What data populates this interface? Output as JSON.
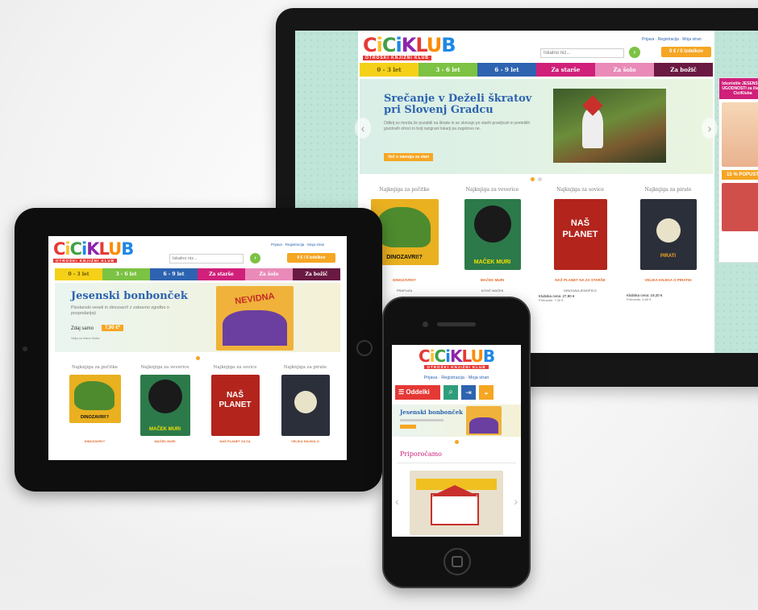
{
  "site": {
    "logo_letters": [
      "C",
      "i",
      "C",
      "i",
      "K",
      "L",
      "U",
      "B"
    ],
    "logo_tag": "OTROŠKI KNJIŽNI KLUB",
    "toplinks": "Prijava · Registracija · Moja stran",
    "search_placeholder": "Iskalno niz...",
    "cart_label": "0 € / 0 izdelkov",
    "nav": [
      "0 - 3 let",
      "3 - 6 let",
      "6 - 9 let",
      "Za starše",
      "Za šolo",
      "Za božič"
    ],
    "columns": [
      "Najknjiga za počitke",
      "Najknjiga za veverice",
      "Najknjiga za sovice",
      "Najknjiga za pirate"
    ],
    "products": [
      "DINOZAVRI!?",
      "MAČEK MURI",
      "NAŠ PLANET NA ZA STARŠE",
      "VELIKA KNJIGA O PIRATIH"
    ],
    "product_short": [
      "DINOZAVRI!?",
      "MAČEK MURI",
      "NAŠ PLANET ZA ZA",
      "VELIKA KNJIGA O"
    ]
  },
  "laptop": {
    "hero_title": "Srečanje v Deželi škratov pri Slovenj Gradcu",
    "hero_text": "Odkrij so morda že pozabili na škrate in se skrivajo po starih pravljicah in preteklih gozdovih otroci in bolj razigrani lokarji pa zagotovo ne.",
    "hero_button": "Več o nanogu za stari",
    "side_banner": "Izkoristite JESENSKE UGODNOSTI za člane CiciKluba",
    "side_badge": "15 % POPUST",
    "price_labels": [
      "Klubska cena: 27,90 €",
      "Klubska cena: 19,20 €"
    ],
    "old_prices": [
      "Prihranite: 7,00 €",
      "Prihranite: 4,80 €"
    ],
    "subtitles": [
      "PRAPLIZA",
      "KOVIČ MAČEK",
      "DINOSAVLJENOPICO"
    ]
  },
  "tablet": {
    "hero_title": "Jesenski bonbonček",
    "hero_text": "Pisolanski veseli in dinozavri! z zabavno zgodbo o pospodarijeji",
    "price_label": "Zdaj samo",
    "price_value": "7,90 €*",
    "price_note": "Velja za člane kluba",
    "book_word": "NEVIDNA"
  },
  "phone": {
    "menu_label": "Oddelki",
    "hero_title": "Jesenski bonbonček",
    "section_title": "Priporočamo"
  },
  "colors": {
    "accent": "#f5a623",
    "brand_blue": "#2d63b0",
    "brand_red": "#e53935"
  }
}
